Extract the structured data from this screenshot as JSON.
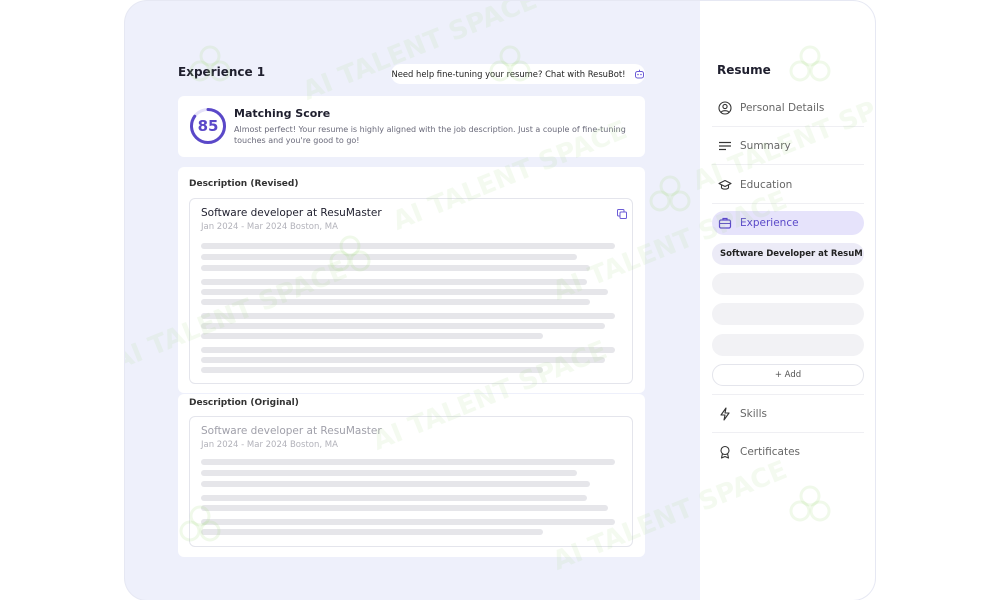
{
  "main": {
    "experience_title": "Experience 1",
    "help_text": "Need help fine-tuning your resume? Chat with ResuBot!",
    "score": {
      "value": "85",
      "percent": 85,
      "title": "Matching Score",
      "description": "Almost perfect! Your resume is highly aligned with the job description. Just a couple of fine-tuning touches and you're good to go!"
    },
    "revised": {
      "label": "Description (Revised)",
      "job_title": "Software developer at ResuMaster",
      "job_meta": "Jan 2024 - Mar 2024 Boston, MA"
    },
    "original": {
      "label": "Description (Original)",
      "job_title": "Software developer at ResuMaster",
      "job_meta": "Jan 2024 - Mar 2024 Boston, MA"
    }
  },
  "sidebar": {
    "title": "Resume",
    "items": [
      {
        "label": "Personal Details",
        "icon": "user-circle-icon"
      },
      {
        "label": "Summary",
        "icon": "lines-icon"
      },
      {
        "label": "Education",
        "icon": "graduation-cap-icon"
      },
      {
        "label": "Experience",
        "icon": "briefcase-icon",
        "active": true
      },
      {
        "label": "Skills",
        "icon": "lightning-icon"
      },
      {
        "label": "Certificates",
        "icon": "award-icon"
      }
    ],
    "experience_sub": "Software Developer at ResuM",
    "add_label": "+ Add"
  },
  "watermark": {
    "text": "AI TALENT SPACE"
  },
  "colors": {
    "accent": "#5a48c8",
    "active_bg": "#e6e3fb",
    "panel_bg": "#eef0fb"
  }
}
